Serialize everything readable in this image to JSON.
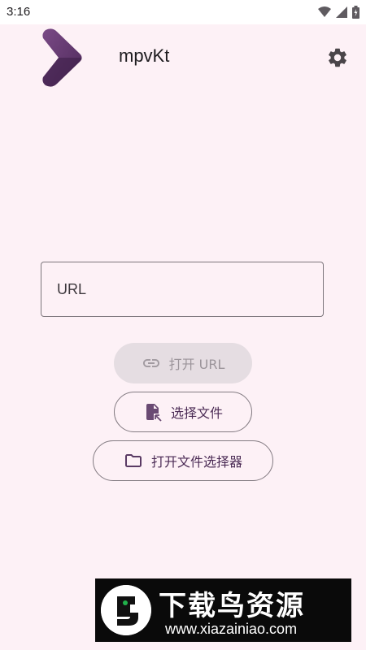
{
  "status_bar": {
    "time": "3:16",
    "icons": [
      "wifi-icon",
      "signal-icon",
      "battery-icon"
    ]
  },
  "app_bar": {
    "title": "mpvKt",
    "logo": "mpvkt-logo",
    "settings_icon": "gear-icon"
  },
  "url_input": {
    "placeholder": "URL",
    "value": ""
  },
  "buttons": {
    "open_url": {
      "label": "打开 URL",
      "icon": "link-icon",
      "enabled": false
    },
    "pick_file": {
      "label": "选择文件",
      "icon": "file-select-icon"
    },
    "open_file_picker": {
      "label": "打开文件选择器",
      "icon": "folder-icon"
    }
  },
  "watermark": {
    "title": "下载鸟资源",
    "url": "www.xiazainiao.com"
  },
  "colors": {
    "background": "#fdf1f6",
    "accent": "#4b2b55",
    "disabled_button": "#e5dde2",
    "outline": "#837b82"
  }
}
